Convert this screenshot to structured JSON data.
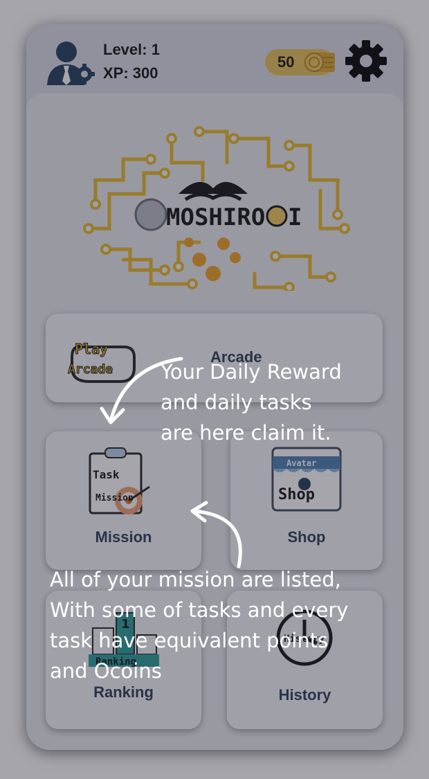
{
  "header": {
    "level_label": "Level: 1",
    "xp_label": "XP: 300",
    "coins": "50"
  },
  "logo": {
    "text": "MOSHIRO",
    "text_end": "I"
  },
  "menu": {
    "arcade": {
      "label": "Arcade",
      "icon_line1": "Play",
      "icon_line2": "Arcade"
    },
    "mission": {
      "label": "Mission",
      "icon_line1": "Task",
      "icon_line2": "Mission"
    },
    "shop": {
      "label": "Shop",
      "icon_line1": "Avatar",
      "icon_line2": "Shop"
    },
    "ranking": {
      "label": "Ranking",
      "icon_line1": "Ranking",
      "icon_rank": "1"
    },
    "history": {
      "label": "History",
      "icon_line1": "History"
    }
  },
  "tooltips": {
    "daily": [
      "Your Daily Reward",
      "and daily tasks",
      "are here claim it."
    ],
    "mission": [
      "All of your mission are listed,",
      "With some of tasks and every",
      "task have equivalent points",
      "and Ocoins"
    ]
  },
  "colors": {
    "accent": "#e9c155",
    "circuit": "#e8b923",
    "label": "#2b3a55",
    "overlay": "rgba(40,40,55,0.42)"
  }
}
